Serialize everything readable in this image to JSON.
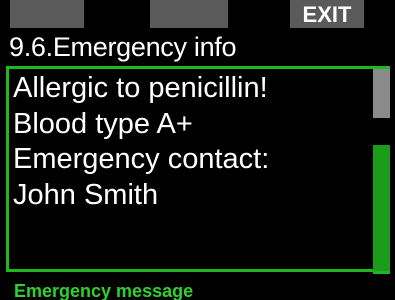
{
  "softkeys": {
    "left": "",
    "middle": "",
    "right": "EXIT"
  },
  "title": "9.6.Emergency info",
  "message": {
    "lines": [
      "Allergic to penicillin!",
      "Blood type A+",
      "Emergency contact:",
      "John Smith"
    ]
  },
  "footer": "Emergency message",
  "colors": {
    "background": "#000000",
    "accent_green": "#1db81d",
    "softkey_gray": "#5a5a5a",
    "footer_text": "#2ed12e"
  }
}
